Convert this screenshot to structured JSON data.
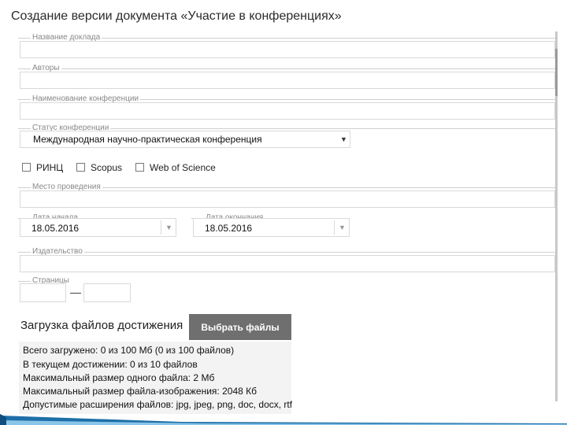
{
  "page": {
    "title": "Создание версии документа «Участие в конференциях»"
  },
  "fields": {
    "report_title": {
      "legend": "Название доклада",
      "value": ""
    },
    "authors": {
      "legend": "Авторы",
      "value": ""
    },
    "conference_name": {
      "legend": "Наименование конференции",
      "value": ""
    },
    "conference_status": {
      "legend": "Статус конференции",
      "value": "Международная научно-практическая конференция"
    },
    "venue": {
      "legend": "Место проведения",
      "value": ""
    },
    "start_date": {
      "legend": "Дата начала",
      "value": "18.05.2016"
    },
    "end_date": {
      "legend": "Дата окончания",
      "value": "18.05.2016"
    },
    "publisher": {
      "legend": "Издательство",
      "value": ""
    },
    "pages": {
      "legend": "Страницы",
      "from": "",
      "to": "",
      "separator": "—"
    }
  },
  "checkboxes": [
    {
      "label": "РИНЦ",
      "checked": false
    },
    {
      "label": "Scopus",
      "checked": false
    },
    {
      "label": "Web of Science",
      "checked": false
    }
  ],
  "upload": {
    "title": "Загрузка файлов достижения",
    "button_label": "Выбрать файлы",
    "info": [
      "Всего загружено: 0 из 100 Мб (0 из 100 файлов)",
      "В текущем достижении: 0 из 10 файлов",
      "Максимальный размер одного файла: 2 Мб",
      "Максимальный размер файла-изображения: 2048 Кб",
      "Допустимые расширения файлов: jpg, jpeg, png, doc, docx, rtf"
    ]
  },
  "icons": {
    "dropdown": "chevron-down-icon",
    "date_dropdown": "chevron-down-icon"
  },
  "colors": {
    "button_bg": "#6f6f6f",
    "button_text": "#ffffff",
    "info_bg": "#f3f3f3",
    "decor_blue": "#1e6fa8",
    "decor_light": "#8ac6e8"
  }
}
